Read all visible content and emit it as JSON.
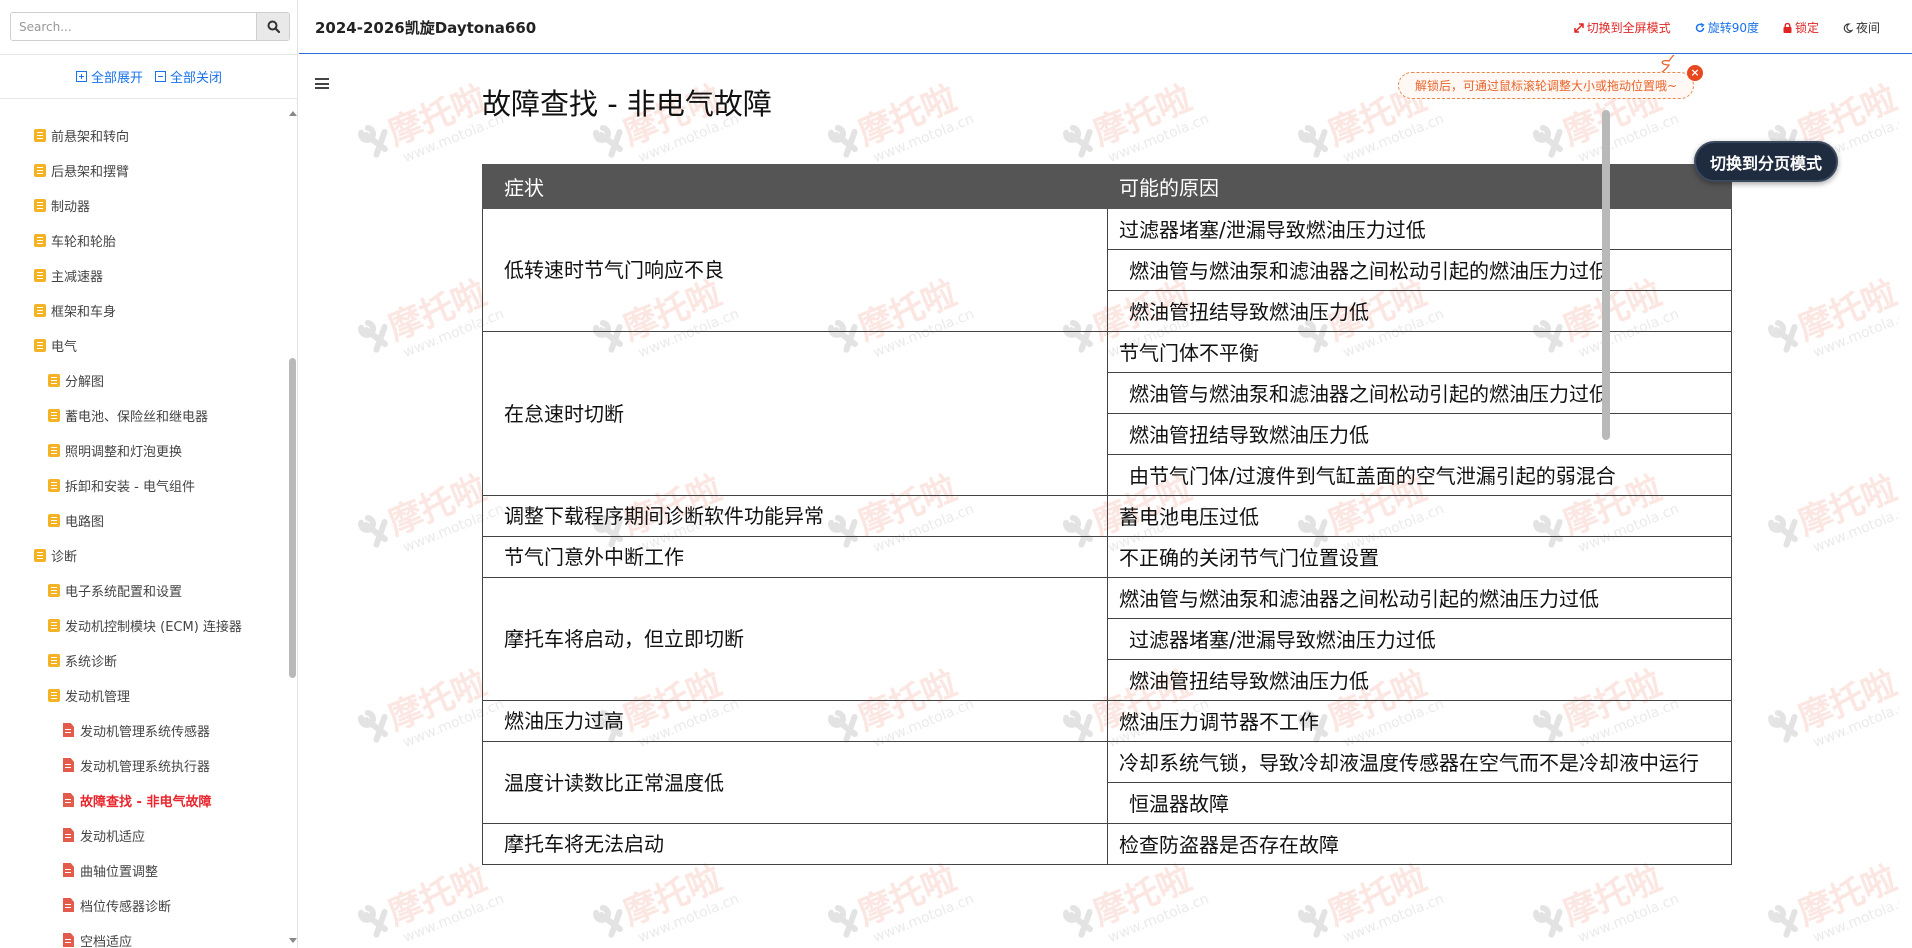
{
  "search": {
    "placeholder": "Search..."
  },
  "tree_controls": {
    "expand_all": "全部展开",
    "collapse_all": "全部关闭"
  },
  "tree": {
    "items": [
      {
        "label": "前悬架和转向",
        "level": 0,
        "icon": "folder"
      },
      {
        "label": "后悬架和摆臂",
        "level": 0,
        "icon": "folder"
      },
      {
        "label": "制动器",
        "level": 0,
        "icon": "folder"
      },
      {
        "label": "车轮和轮胎",
        "level": 0,
        "icon": "folder"
      },
      {
        "label": "主减速器",
        "level": 0,
        "icon": "folder"
      },
      {
        "label": "框架和车身",
        "level": 0,
        "icon": "folder"
      },
      {
        "label": "电气",
        "level": 0,
        "icon": "folder"
      },
      {
        "label": "分解图",
        "level": 1,
        "icon": "folder"
      },
      {
        "label": "蓄电池、保险丝和继电器",
        "level": 1,
        "icon": "folder"
      },
      {
        "label": "照明调整和灯泡更换",
        "level": 1,
        "icon": "folder"
      },
      {
        "label": "拆卸和安装 - 电气组件",
        "level": 1,
        "icon": "folder"
      },
      {
        "label": "电路图",
        "level": 1,
        "icon": "folder"
      },
      {
        "label": "诊断",
        "level": 0,
        "icon": "folder"
      },
      {
        "label": "电子系统配置和设置",
        "level": 1,
        "icon": "folder"
      },
      {
        "label": "发动机控制模块 (ECM) 连接器",
        "level": 1,
        "icon": "folder"
      },
      {
        "label": "系统诊断",
        "level": 1,
        "icon": "folder"
      },
      {
        "label": "发动机管理",
        "level": 1,
        "icon": "folder"
      },
      {
        "label": "发动机管理系统传感器",
        "level": 2,
        "icon": "document"
      },
      {
        "label": "发动机管理系统执行器",
        "level": 2,
        "icon": "document"
      },
      {
        "label": "故障查找 - 非电气故障",
        "level": 2,
        "icon": "document",
        "active": true
      },
      {
        "label": "发动机适应",
        "level": 2,
        "icon": "document"
      },
      {
        "label": "曲轴位置调整",
        "level": 2,
        "icon": "document"
      },
      {
        "label": "档位传感器诊断",
        "level": 2,
        "icon": "document"
      },
      {
        "label": "空档适应",
        "level": 2,
        "icon": "document"
      }
    ]
  },
  "header": {
    "title": "2024-2026凯旋Daytona660",
    "tools": {
      "fullscreen": "切换到全屏模式",
      "rotate": "旋转90度",
      "lock": "锁定",
      "night": "夜间"
    }
  },
  "hint": {
    "text": "解锁后，可通过鼠标滚轮调整大小或拖动位置哦~",
    "close": "×"
  },
  "switch_button": "切换到分页模式",
  "watermark": {
    "brand": "摩托啦",
    "url": "www.motola.cn"
  },
  "page_title": "故障查找 - 非电气故障",
  "table": {
    "headers": [
      "症状",
      "可能的原因"
    ],
    "rows": [
      {
        "symptom": "低转速时节气门响应不良",
        "causes": [
          "过滤器堵塞/泄漏导致燃油压力过低",
          "燃油管与燃油泵和滤油器之间松动引起的燃油压力过低",
          "燃油管扭结导致燃油压力低"
        ]
      },
      {
        "symptom": "在怠速时切断",
        "causes": [
          "节气门体不平衡",
          "燃油管与燃油泵和滤油器之间松动引起的燃油压力过低",
          "燃油管扭结导致燃油压力低",
          "由节气门体/过渡件到气缸盖面的空气泄漏引起的弱混合"
        ]
      },
      {
        "symptom": "调整下载程序期间诊断软件功能异常",
        "causes": [
          "蓄电池电压过低"
        ]
      },
      {
        "symptom": "节气门意外中断工作",
        "causes": [
          "不正确的关闭节气门位置设置"
        ]
      },
      {
        "symptom": "摩托车将启动，但立即切断",
        "causes": [
          "燃油管与燃油泵和滤油器之间松动引起的燃油压力过低",
          "过滤器堵塞/泄漏导致燃油压力过低",
          "燃油管扭结导致燃油压力低"
        ]
      },
      {
        "symptom": "燃油压力过高",
        "causes": [
          "燃油压力调节器不工作"
        ]
      },
      {
        "symptom": "温度计读数比正常温度低",
        "causes": [
          "冷却系统气锁，导致冷却液温度传感器在空气而不是冷却液中运行",
          "恒温器故障"
        ]
      },
      {
        "symptom": "摩托车将无法启动",
        "causes": [
          "检查防盗器是否存在故障"
        ]
      }
    ]
  }
}
